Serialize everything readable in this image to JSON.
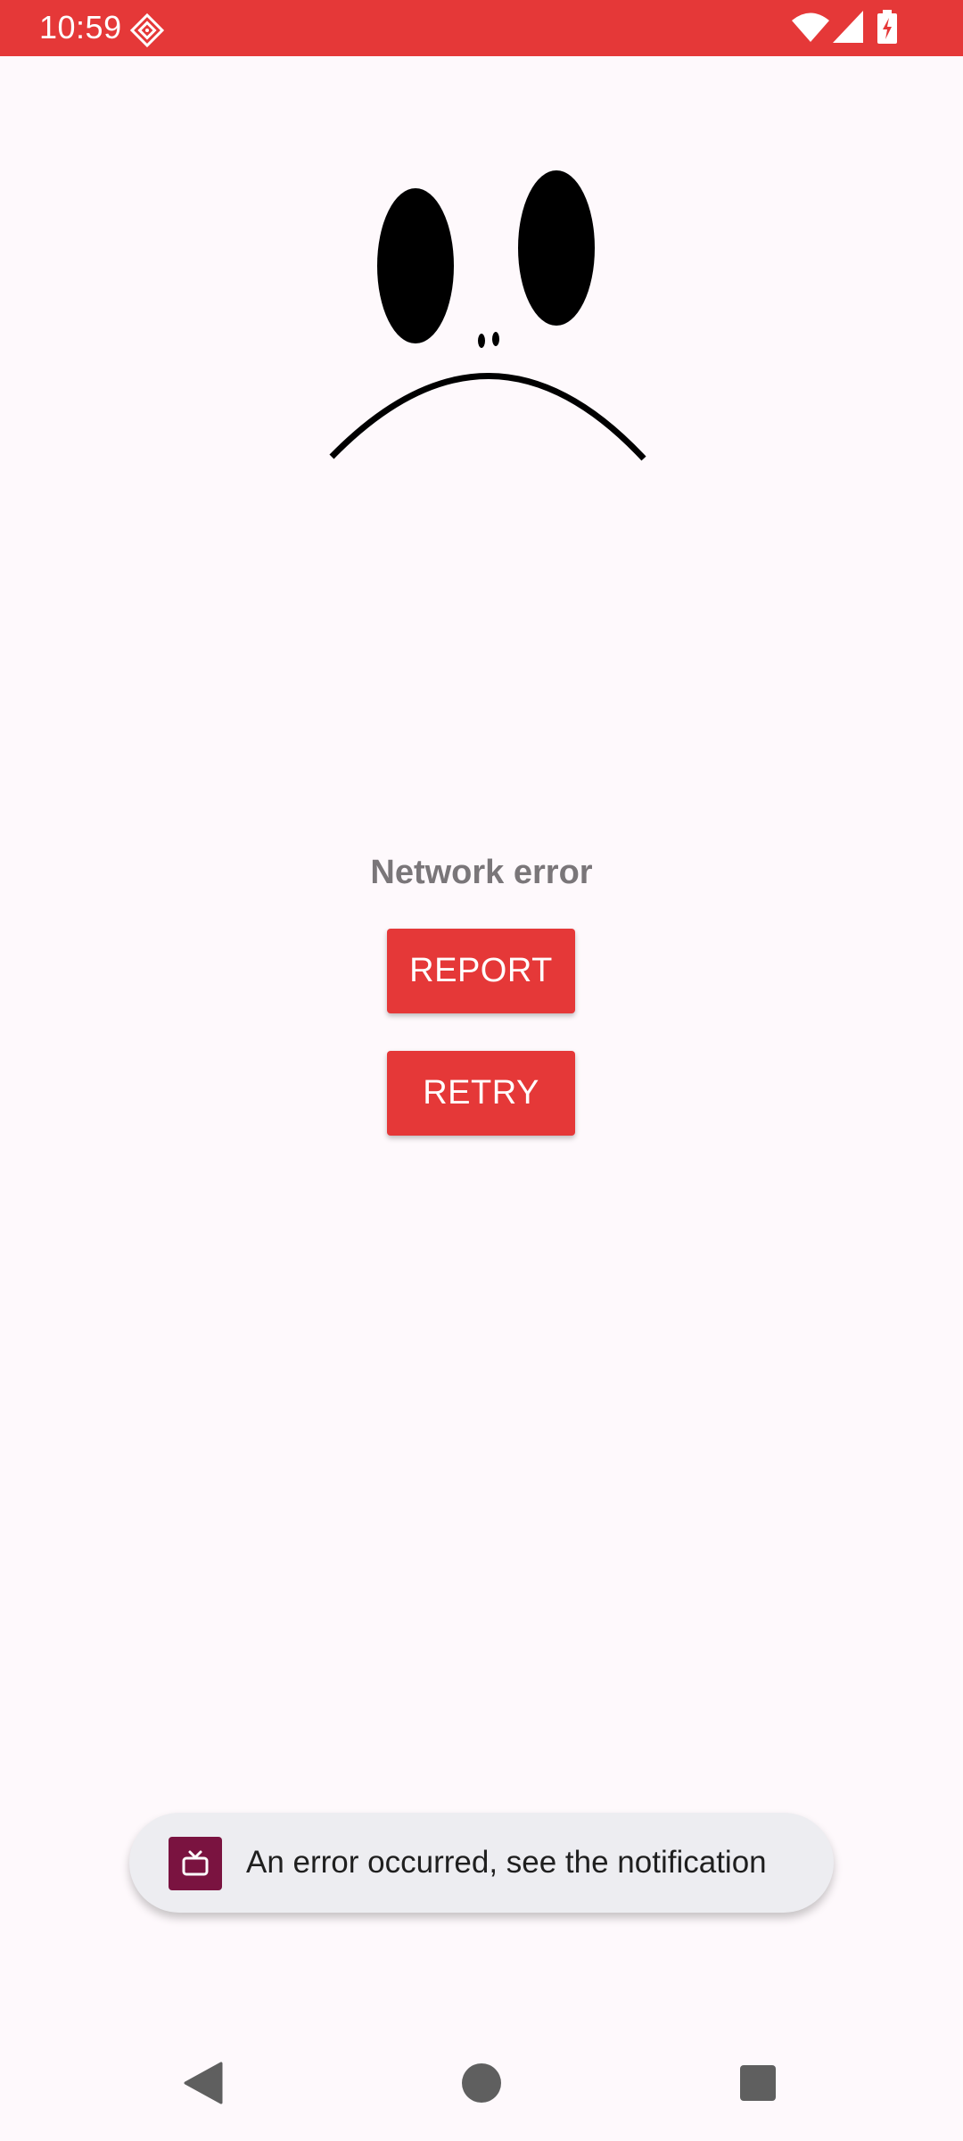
{
  "status_bar": {
    "time": "10:59",
    "color": "#E53838"
  },
  "main": {
    "illustration": "sad-face",
    "error_title": "Network error",
    "report_label": "REPORT",
    "retry_label": "RETRY",
    "button_color": "#E53838"
  },
  "toast": {
    "icon": "tv-icon",
    "message": "An error occurred, see the notification"
  },
  "nav_bar": {
    "items": [
      "back-icon",
      "home-icon",
      "recents-icon"
    ]
  }
}
